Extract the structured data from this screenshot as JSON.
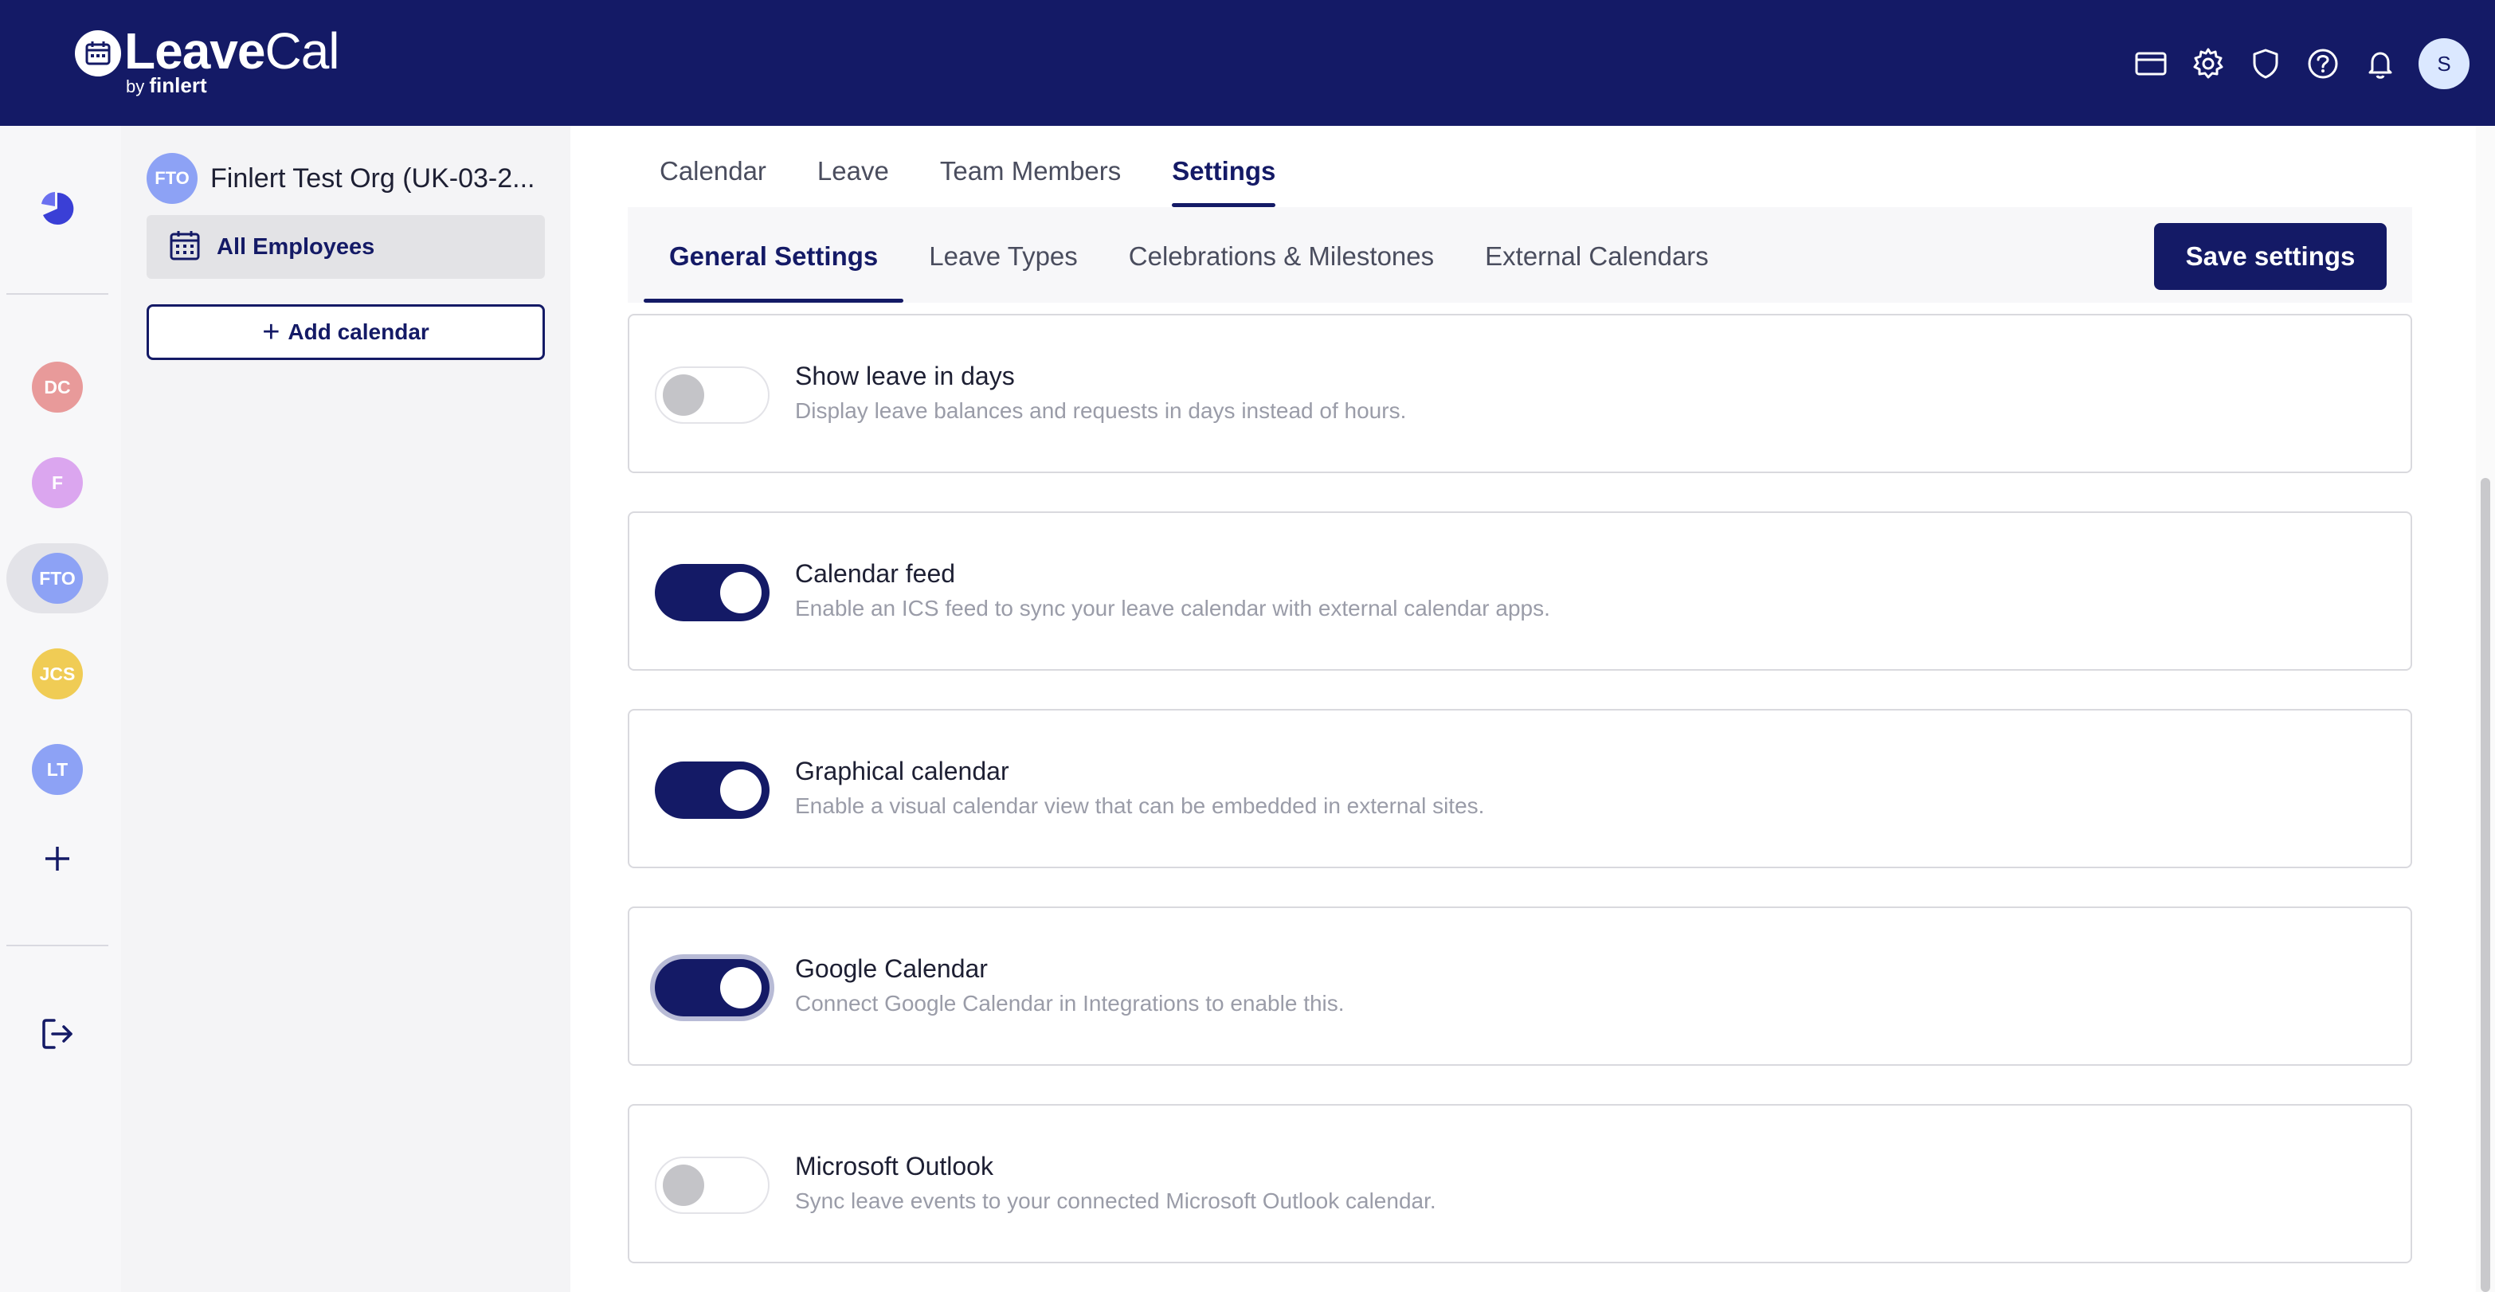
{
  "app": {
    "logo_main": "Leave",
    "logo_light": "Cal",
    "logo_by": "by",
    "logo_by_brand": "finlert"
  },
  "topbar": {
    "icons": [
      "card-icon",
      "gear-icon",
      "shield-icon",
      "help-icon",
      "bell-icon"
    ],
    "user_initial": "S"
  },
  "rail": {
    "items": [
      {
        "initials": "DC",
        "color": "#e89a9a"
      },
      {
        "initials": "F",
        "color": "#dba6ef"
      },
      {
        "initials": "FTO",
        "color": "#8da2f5",
        "active": true
      },
      {
        "initials": "JCS",
        "color": "#f0cc55"
      },
      {
        "initials": "LT",
        "color": "#8da2f5"
      }
    ]
  },
  "sidebar": {
    "org_initials": "FTO",
    "org_name": "Finlert Test Org (UK-03-2...",
    "calendar_label": "All Employees",
    "add_calendar_label": "Add calendar"
  },
  "main_tabs": [
    "Calendar",
    "Leave",
    "Team Members",
    "Settings"
  ],
  "sub_tabs": [
    "General Settings",
    "Leave Types",
    "Celebrations & Milestones",
    "External Calendars"
  ],
  "save_label": "Save settings",
  "settings": [
    {
      "title": "Show leave in days",
      "desc": "Display leave balances and requests in days instead of hours.",
      "enabled": false
    },
    {
      "title": "Calendar feed",
      "desc": "Enable an ICS feed to sync your leave calendar with external calendar apps.",
      "enabled": true
    },
    {
      "title": "Graphical calendar",
      "desc": "Enable a visual calendar view that can be embedded in external sites.",
      "enabled": true
    },
    {
      "title": "Google Calendar",
      "desc": "Connect Google Calendar in Integrations to enable this.",
      "enabled": true
    },
    {
      "title": "Microsoft Outlook",
      "desc": "Sync leave events to your connected Microsoft Outlook calendar.",
      "enabled": false
    }
  ],
  "colors": {
    "brand": "#141a66",
    "toggle_off_knob": "#c4c4c8"
  }
}
